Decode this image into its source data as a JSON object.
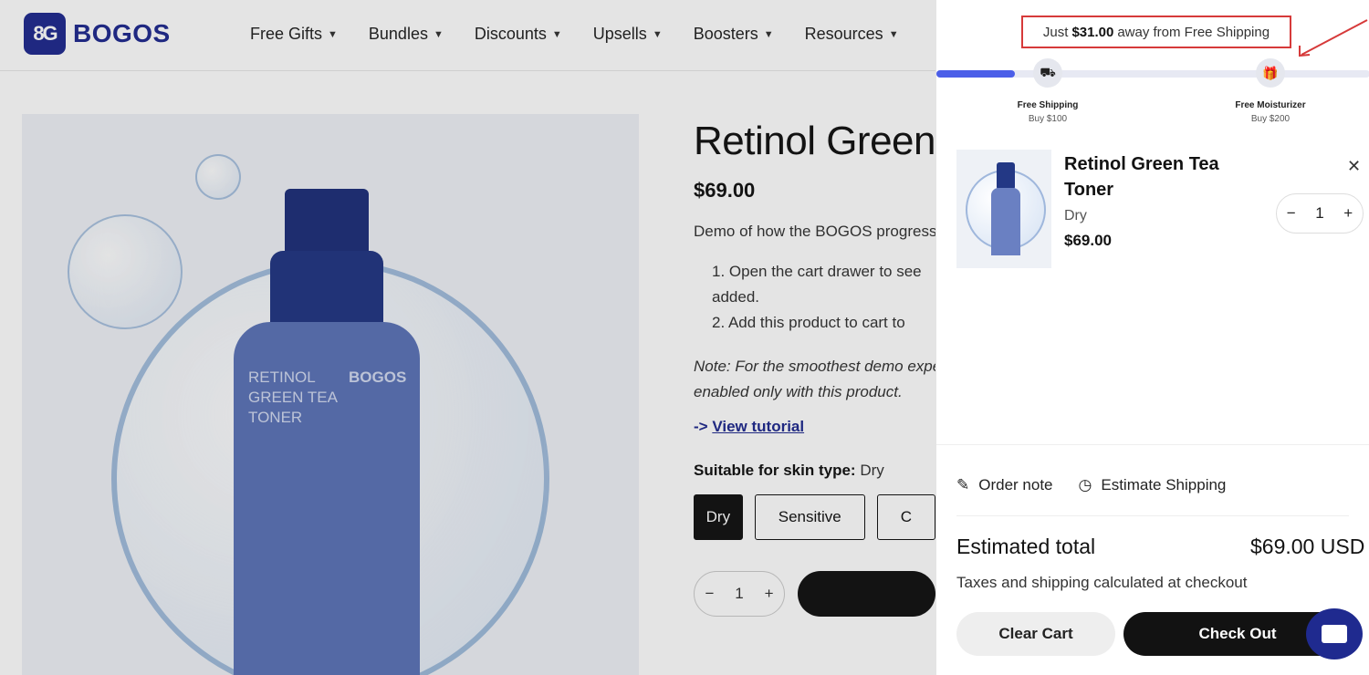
{
  "brand": {
    "name": "BOGOS",
    "mark": "8G"
  },
  "nav": [
    {
      "label": "Free Gifts"
    },
    {
      "label": "Bundles"
    },
    {
      "label": "Discounts"
    },
    {
      "label": "Upsells"
    },
    {
      "label": "Boosters"
    },
    {
      "label": "Resources"
    }
  ],
  "product": {
    "title": "Retinol Green Tea Toner",
    "price": "$69.00",
    "description": "Demo of how the BOGOS progress bar works.",
    "steps": [
      "1. Open the cart drawer to see",
      "added.",
      "2. Add this product to cart to"
    ],
    "note_line1": "Note: For the smoothest demo experience,",
    "note_line2": "enabled only with this product.",
    "tutorial_arrow": "->",
    "tutorial_label": "View tutorial",
    "skin_label": "Suitable for skin type:",
    "skin_value": "Dry",
    "variants": [
      "Dry",
      "Sensitive",
      "C"
    ],
    "quantity": "1",
    "bottle_text_left": "RETINOL\nGREEN TEA\nTONER",
    "bottle_brand": "BOGOS"
  },
  "cart": {
    "shipping_message_prefix": "Just",
    "shipping_message_amount": "$31.00",
    "shipping_message_suffix": "away from Free Shipping",
    "progress_fraction": 0.18,
    "milestones": [
      {
        "title": "Free Shipping",
        "subtitle": "Buy $100",
        "icon": "truck-icon"
      },
      {
        "title": "Free Moisturizer",
        "subtitle": "Buy $200",
        "icon": "gift-icon"
      }
    ],
    "item": {
      "name": "Retinol Green Tea Toner",
      "variant": "Dry",
      "price": "$69.00",
      "quantity": "1"
    },
    "order_note_label": "Order note",
    "estimate_shipping_label": "Estimate Shipping",
    "estimated_total_label": "Estimated total",
    "estimated_total_value": "$69.00 USD",
    "tax_note": "Taxes and shipping calculated at checkout",
    "clear_cart_label": "Clear Cart",
    "checkout_label": "Check Out"
  },
  "colors": {
    "brand": "#1f2a8f",
    "progress": "#4b5ee8",
    "highlight_border": "#d63a3a",
    "primary_button": "#121212"
  }
}
